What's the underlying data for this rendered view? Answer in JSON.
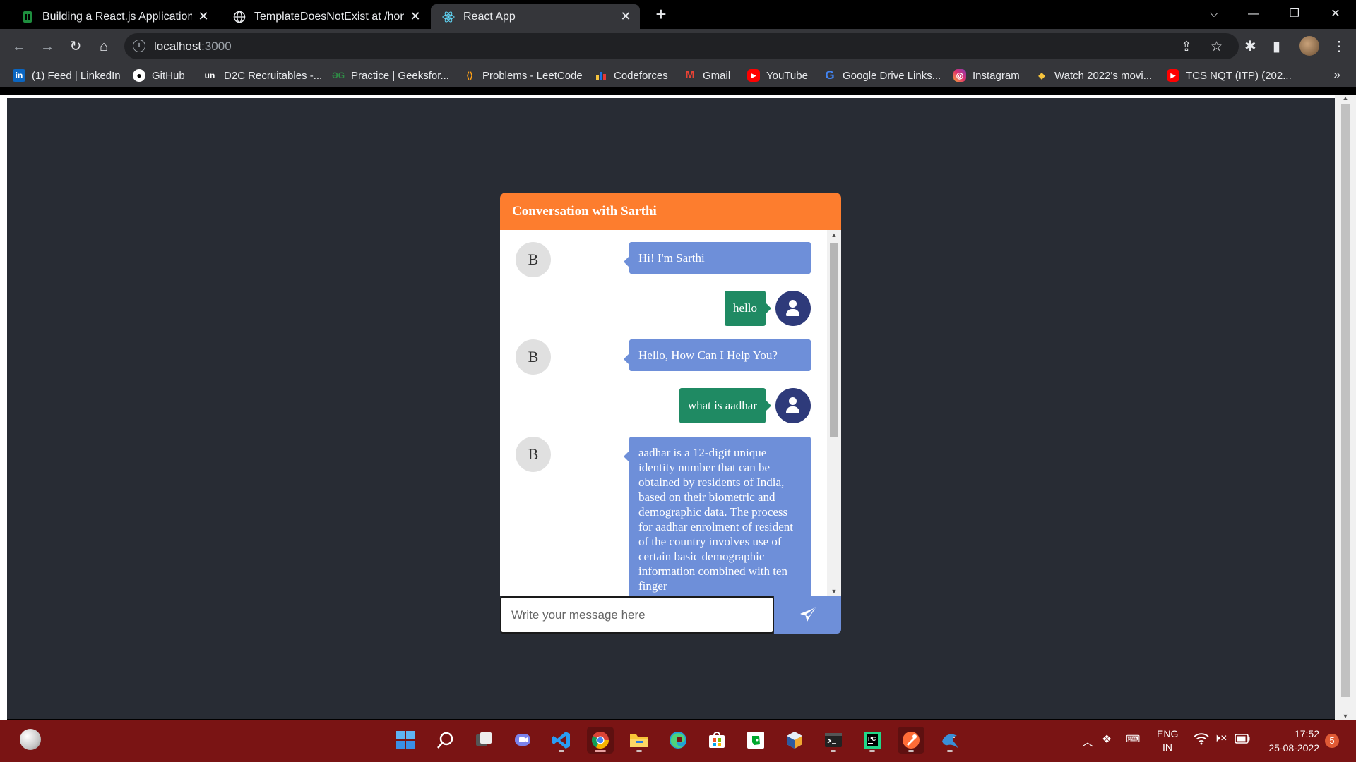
{
  "browser": {
    "tabs": [
      {
        "title": "Building a React.js Application us",
        "icon": "sheet-icon",
        "active": false
      },
      {
        "title": "TemplateDoesNotExist at /home/",
        "icon": "globe-icon",
        "active": false
      },
      {
        "title": "React App",
        "icon": "react-icon",
        "active": true
      }
    ],
    "new_tab_symbol": "+",
    "url_host": "localhost",
    "url_port": ":3000",
    "bookmarks": [
      {
        "label": "(1) Feed | LinkedIn",
        "icon": "linkedin-icon"
      },
      {
        "label": "GitHub",
        "icon": "github-icon"
      },
      {
        "label": "D2C Recruitables -...",
        "icon": "unstop-icon"
      },
      {
        "label": "Practice | Geeksfor...",
        "icon": "geeksforgeeks-icon"
      },
      {
        "label": "Problems - LeetCode",
        "icon": "leetcode-icon"
      },
      {
        "label": "Codeforces",
        "icon": "codeforces-icon"
      },
      {
        "label": "Gmail",
        "icon": "gmail-icon"
      },
      {
        "label": "YouTube",
        "icon": "youtube-icon"
      },
      {
        "label": "Google Drive Links...",
        "icon": "google-icon"
      },
      {
        "label": "Instagram",
        "icon": "instagram-icon"
      },
      {
        "label": "Watch 2022's movi...",
        "icon": "movie-icon"
      },
      {
        "label": "TCS NQT (ITP) (202...",
        "icon": "youtube-icon"
      }
    ],
    "bookmarks_more": "»"
  },
  "chat": {
    "title": "Conversation with Sarthi",
    "bot_initial": "B",
    "messages": [
      {
        "sender": "bot",
        "text": "Hi! I'm Sarthi"
      },
      {
        "sender": "user",
        "text": "hello"
      },
      {
        "sender": "bot",
        "text": "Hello, How Can I Help You?"
      },
      {
        "sender": "user",
        "text": "what is aadhar"
      },
      {
        "sender": "bot",
        "text": "aadhar is a 12-digit unique identity number that can be obtained by residents of India, based on their biometric and demographic data. The process for aadhar enrolment of resident of the country involves use of certain basic demographic information combined with ten finger"
      }
    ],
    "input_placeholder": "Write your message here",
    "colors": {
      "header": "#fd7d2e",
      "bot_bubble": "#6e8fd9",
      "user_bubble": "#1f8a63",
      "user_avatar": "#2e3a7a",
      "page_bg": "#282c34"
    }
  },
  "taskbar": {
    "apps": [
      "start-icon",
      "search-icon",
      "task-view-icon",
      "teams-chat-icon",
      "vscode-icon",
      "chrome-icon",
      "file-explorer-icon",
      "edge-icon",
      "store-icon",
      "evernote-icon",
      "virtualbox-icon",
      "terminal-icon",
      "pycharm-icon",
      "postman-icon",
      "mysql-workbench-icon"
    ],
    "language_line1": "ENG",
    "language_line2": "IN",
    "time": "17:52",
    "date": "25-08-2022",
    "notifications": "5"
  }
}
